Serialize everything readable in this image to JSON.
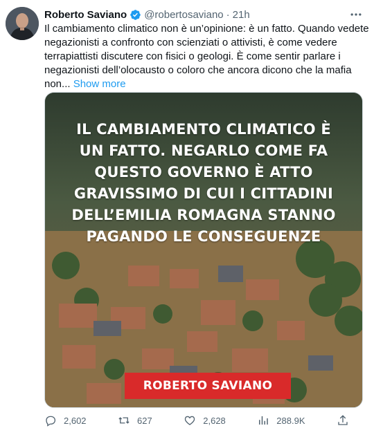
{
  "tweet": {
    "author_name": "Roberto Saviano",
    "handle": "@robertosaviano",
    "separator": "·",
    "time": "21h",
    "text_lines": [
      "Il cambiamento climatico non è un’opinione: è un fatto. Quando vedete",
      "negazionisti a confronto con scienziati o attivisti, è come vedere",
      "terrapiattisti discutere con fisici o geologi. È come sentir parlare i",
      "negazionisti dell’olocausto o coloro che ancora dicono che la mafia",
      "non..."
    ],
    "show_more": "Show more",
    "image_text_lines": [
      "IL CAMBIAMENTO CLIMATICO È",
      "UN FATTO. NEGARLO COME FA",
      "QUESTO GOVERNO È ATTO",
      "GRAVISSIMO DI CUI I CITTADINI",
      "DELL’EMILIA ROMAGNA STANNO",
      "PAGANDO LE CONSEGUENZE"
    ],
    "image_badge": "ROBERTO SAVIANO"
  },
  "actions": {
    "replies": "2,602",
    "retweets": "627",
    "likes": "2,628",
    "views": "288.9K"
  },
  "colors": {
    "accent": "#1d9bf0",
    "secondary_text": "#536471",
    "badge_red": "#d92a2a",
    "flood_water": "#8a7048"
  },
  "icons": [
    "verified-badge-icon",
    "more-options-icon",
    "reply-icon",
    "retweet-icon",
    "like-icon",
    "views-icon",
    "share-icon"
  ]
}
